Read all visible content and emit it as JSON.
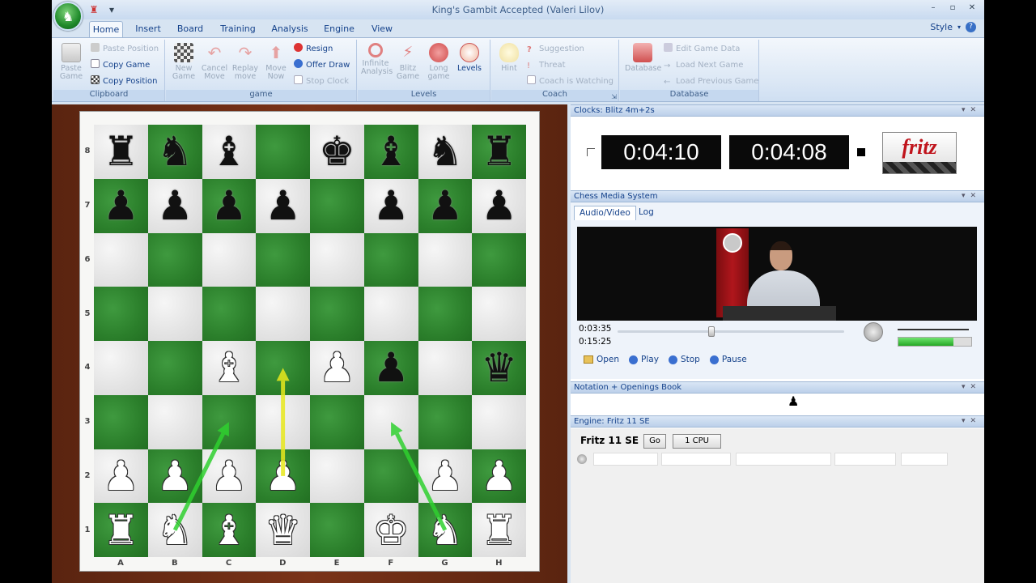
{
  "window": {
    "title": "King's Gambit Accepted  (Valeri Lilov)"
  },
  "tabs": [
    "Home",
    "Insert",
    "Board",
    "Training",
    "Analysis",
    "Engine",
    "View"
  ],
  "style_menu": "Style",
  "ribbon": {
    "clipboard": {
      "label": "Clipboard",
      "paste_game": "Paste Game",
      "paste_position": "Paste Position",
      "copy_game": "Copy Game",
      "copy_position": "Copy Position"
    },
    "game": {
      "label": "game",
      "new_game": "New Game",
      "cancel_move": "Cancel Move",
      "replay_move": "Replay move",
      "move_now": "Move Now",
      "resign": "Resign",
      "offer_draw": "Offer Draw",
      "stop_clock": "Stop Clock"
    },
    "levels": {
      "label": "Levels",
      "infinite_analysis": "Infinite Analysis",
      "blitz_game": "Blitz Game",
      "long_game": "Long game",
      "levels_btn": "Levels"
    },
    "coach": {
      "label": "Coach",
      "hint": "Hint",
      "suggestion": "Suggestion",
      "threat": "Threat",
      "coach_warning": "Coach is Watching"
    },
    "database": {
      "label": "Database",
      "database_btn": "Database",
      "edit_game_data": "Edit Game Data",
      "load_next_game": "Load Next Game",
      "load_previous_game": "Load Previous Game"
    }
  },
  "board": {
    "ranks": [
      "8",
      "7",
      "6",
      "5",
      "4",
      "3",
      "2",
      "1"
    ],
    "files": [
      "A",
      "B",
      "C",
      "D",
      "E",
      "F",
      "G",
      "H"
    ],
    "position": [
      [
        "br",
        "bn",
        "bb",
        "",
        "bk",
        "bb",
        "bn",
        "br"
      ],
      [
        "bp",
        "bp",
        "bp",
        "bp",
        "",
        "bp",
        "bp",
        "bp"
      ],
      [
        "",
        "",
        "",
        "",
        "",
        "",
        "",
        ""
      ],
      [
        "",
        "",
        "",
        "",
        "",
        "",
        "",
        ""
      ],
      [
        "",
        "",
        "wb",
        "",
        "wp",
        "bp",
        "",
        "bq"
      ],
      [
        "",
        "",
        "",
        "",
        "",
        "",
        "",
        ""
      ],
      [
        "wp",
        "wp",
        "wp",
        "wp",
        "",
        "",
        "wp",
        "wp"
      ],
      [
        "wr",
        "wn",
        "wb",
        "wq",
        "",
        "wk",
        "wn",
        "wr"
      ]
    ],
    "arrows": [
      {
        "from": "b1",
        "to": "c3",
        "color": "#2fd02f"
      },
      {
        "from": "d2",
        "to": "d4",
        "color": "#e8e81c"
      },
      {
        "from": "g1",
        "to": "f3",
        "color": "#2fd02f"
      }
    ]
  },
  "clocks": {
    "panel_title": "Clocks: Blitz 4m+2s",
    "white_time": "0:04:10",
    "black_time": "0:04:08",
    "logo_text": "fritz"
  },
  "media": {
    "panel_title": "Chess Media System",
    "tab_audio_video": "Audio/Video",
    "tab_log": "Log",
    "current_time": "0:03:35",
    "total_time": "0:15:25",
    "volume_level": 0.75,
    "buttons": {
      "open": "Open",
      "play": "Play",
      "stop": "Stop",
      "pause": "Pause"
    }
  },
  "notation": {
    "panel_title": "Notation + Openings Book"
  },
  "engine": {
    "panel_title": "Engine: Fritz 11 SE",
    "name": "Fritz 11 SE",
    "go": "Go",
    "cpu": "1 CPU"
  },
  "colors": {
    "light_square": "#e3e3e3",
    "dark_square": "#2b7f2b",
    "accent": "#15428b",
    "clock_bg": "#0a0a0a"
  }
}
